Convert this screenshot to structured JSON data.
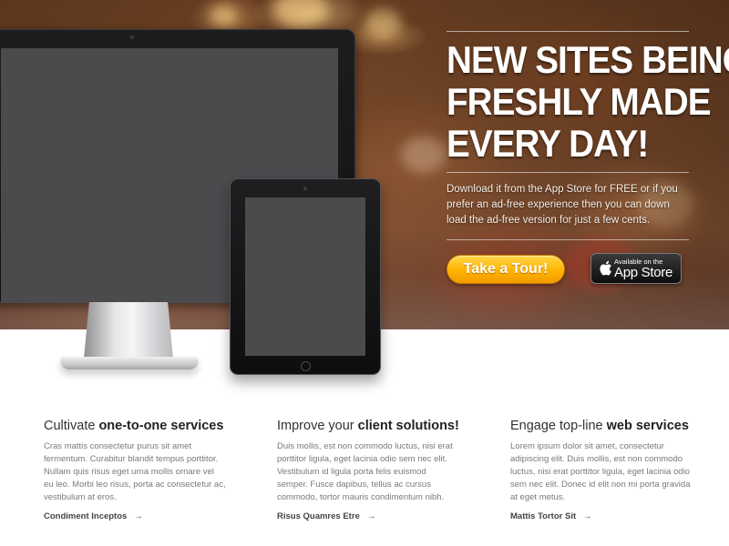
{
  "hero": {
    "headline": [
      "NEW SITES BEING",
      "FRESHLY MADE",
      "EVERY DAY!"
    ],
    "description": "Download it from the App Store for FREE or if you prefer an ad-free experience then you can down load the ad-free version for just a few cents.",
    "tour_button": "Take a Tour!",
    "appstore_small": "Available on the",
    "appstore_big": "App Store"
  },
  "features": [
    {
      "title_plain": "Cultivate ",
      "title_bold": "one-to-one services",
      "body": "Cras mattis consectetur purus sit amet fermentum. Curabitur blandit tempus porttitor. Nullam quis risus eget urna mollis ornare vel eu leo. Morbi leo risus, porta ac consectetur ac, vestibulum at eros.",
      "link": "Condiment Inceptos",
      "arrow": "→"
    },
    {
      "title_plain": "Improve your ",
      "title_bold": "client solutions!",
      "body": "Duis mollis, est non commodo luctus, nisi erat porttitor ligula, eget lacinia odio sem nec elit. Vestibulum id ligula porta felis euismod semper. Fusce dapibus, tellus ac cursus commodo, tortor mauris condimentum nibh.",
      "link": "Risus Quamres Etre",
      "arrow": "→"
    },
    {
      "title_plain": "Engage top-line ",
      "title_bold": "web services",
      "body": "Lorem ipsum dolor sit amet, consectetur adipiscing elit. Duis mollis, est non commodo luctus, nisi erat porttitor ligula, eget lacinia odio sem nec elit. Donec id elit non mi porta gravida at eget metus.",
      "link": "Mattis Tortor Sit",
      "arrow": "→"
    }
  ],
  "colors": {
    "tour_button": "#ffb400",
    "appstore_button": "#0d0d0d",
    "heading_text": "#222222",
    "body_text": "#7a7a7a"
  },
  "icons": {
    "appstore": "apple-icon",
    "link_arrow": "arrow-right-icon"
  }
}
